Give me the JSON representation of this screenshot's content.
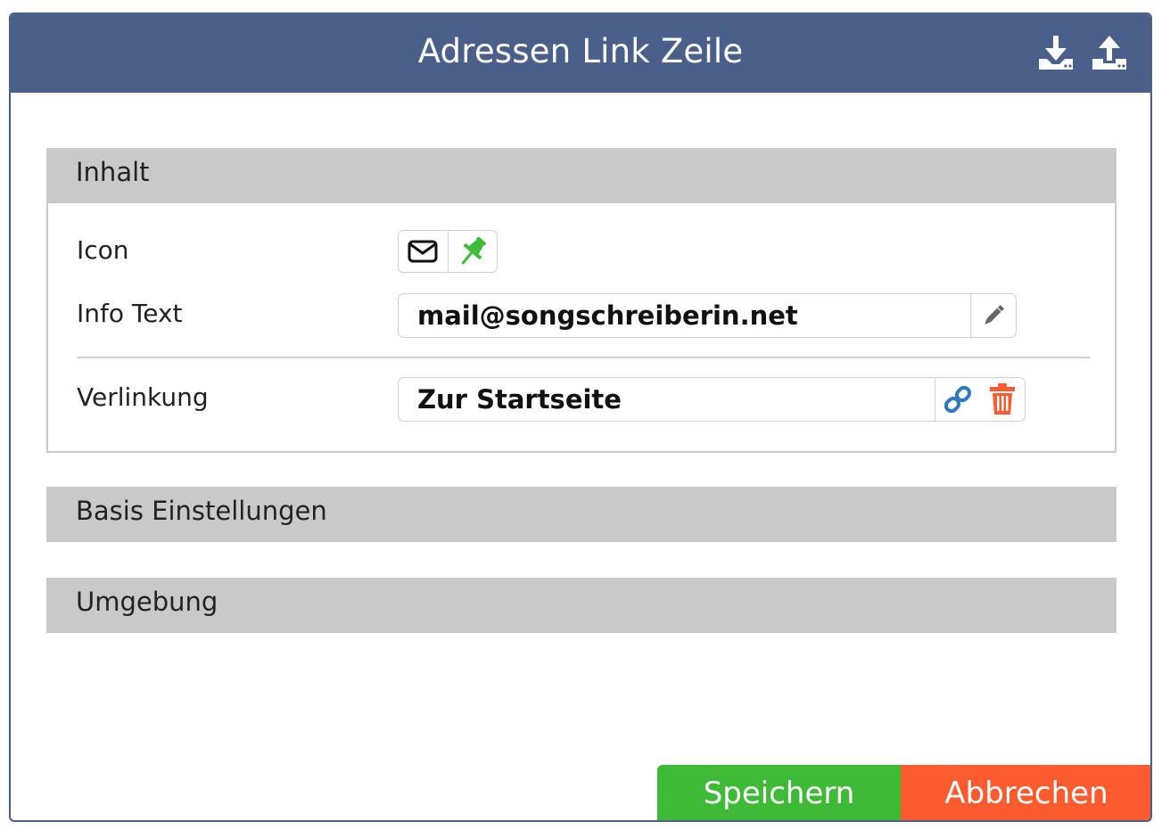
{
  "dialog": {
    "title": "Adressen Link Zeile",
    "header_icons": [
      "download-icon",
      "upload-icon"
    ],
    "header_color": "#4a5f8a"
  },
  "sections": {
    "inhalt": {
      "title": "Inhalt",
      "rows": {
        "icon": {
          "label": "Icon",
          "icons": [
            "envelope-icon",
            "pin-icon"
          ]
        },
        "info_text": {
          "label": "Info Text",
          "value": "mail@songschreiberin.net",
          "action_icon": "pencil-icon"
        },
        "verlinkung": {
          "label": "Verlinkung",
          "value": "Zur Startseite",
          "action_icons": [
            "link-icon",
            "trash-icon"
          ]
        }
      }
    },
    "basis": {
      "title": "Basis Einstellungen"
    },
    "umgebung": {
      "title": "Umgebung"
    }
  },
  "footer": {
    "save_label": "Speichern",
    "cancel_label": "Abbrechen",
    "save_color": "#3fba36",
    "cancel_color": "#fb5b2e"
  }
}
